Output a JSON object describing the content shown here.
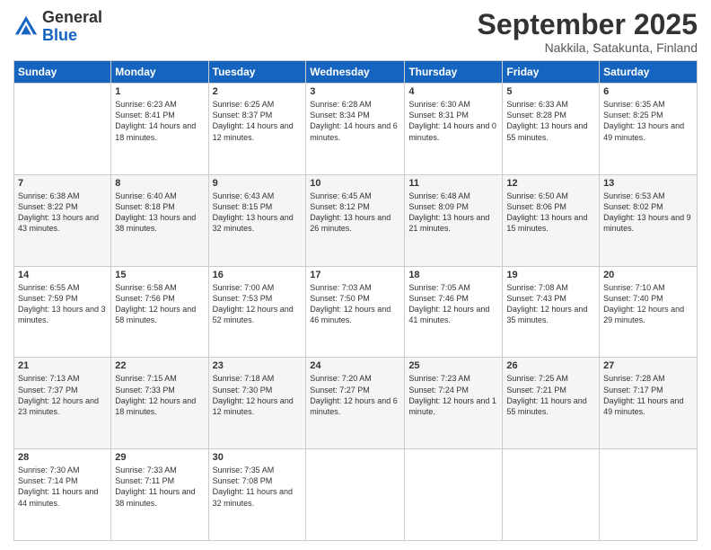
{
  "logo": {
    "general": "General",
    "blue": "Blue"
  },
  "header": {
    "month": "September 2025",
    "location": "Nakkila, Satakunta, Finland"
  },
  "days_of_week": [
    "Sunday",
    "Monday",
    "Tuesday",
    "Wednesday",
    "Thursday",
    "Friday",
    "Saturday"
  ],
  "weeks": [
    [
      {
        "day": "",
        "sunrise": "",
        "sunset": "",
        "daylight": ""
      },
      {
        "day": "1",
        "sunrise": "Sunrise: 6:23 AM",
        "sunset": "Sunset: 8:41 PM",
        "daylight": "Daylight: 14 hours and 18 minutes."
      },
      {
        "day": "2",
        "sunrise": "Sunrise: 6:25 AM",
        "sunset": "Sunset: 8:37 PM",
        "daylight": "Daylight: 14 hours and 12 minutes."
      },
      {
        "day": "3",
        "sunrise": "Sunrise: 6:28 AM",
        "sunset": "Sunset: 8:34 PM",
        "daylight": "Daylight: 14 hours and 6 minutes."
      },
      {
        "day": "4",
        "sunrise": "Sunrise: 6:30 AM",
        "sunset": "Sunset: 8:31 PM",
        "daylight": "Daylight: 14 hours and 0 minutes."
      },
      {
        "day": "5",
        "sunrise": "Sunrise: 6:33 AM",
        "sunset": "Sunset: 8:28 PM",
        "daylight": "Daylight: 13 hours and 55 minutes."
      },
      {
        "day": "6",
        "sunrise": "Sunrise: 6:35 AM",
        "sunset": "Sunset: 8:25 PM",
        "daylight": "Daylight: 13 hours and 49 minutes."
      }
    ],
    [
      {
        "day": "7",
        "sunrise": "Sunrise: 6:38 AM",
        "sunset": "Sunset: 8:22 PM",
        "daylight": "Daylight: 13 hours and 43 minutes."
      },
      {
        "day": "8",
        "sunrise": "Sunrise: 6:40 AM",
        "sunset": "Sunset: 8:18 PM",
        "daylight": "Daylight: 13 hours and 38 minutes."
      },
      {
        "day": "9",
        "sunrise": "Sunrise: 6:43 AM",
        "sunset": "Sunset: 8:15 PM",
        "daylight": "Daylight: 13 hours and 32 minutes."
      },
      {
        "day": "10",
        "sunrise": "Sunrise: 6:45 AM",
        "sunset": "Sunset: 8:12 PM",
        "daylight": "Daylight: 13 hours and 26 minutes."
      },
      {
        "day": "11",
        "sunrise": "Sunrise: 6:48 AM",
        "sunset": "Sunset: 8:09 PM",
        "daylight": "Daylight: 13 hours and 21 minutes."
      },
      {
        "day": "12",
        "sunrise": "Sunrise: 6:50 AM",
        "sunset": "Sunset: 8:06 PM",
        "daylight": "Daylight: 13 hours and 15 minutes."
      },
      {
        "day": "13",
        "sunrise": "Sunrise: 6:53 AM",
        "sunset": "Sunset: 8:02 PM",
        "daylight": "Daylight: 13 hours and 9 minutes."
      }
    ],
    [
      {
        "day": "14",
        "sunrise": "Sunrise: 6:55 AM",
        "sunset": "Sunset: 7:59 PM",
        "daylight": "Daylight: 13 hours and 3 minutes."
      },
      {
        "day": "15",
        "sunrise": "Sunrise: 6:58 AM",
        "sunset": "Sunset: 7:56 PM",
        "daylight": "Daylight: 12 hours and 58 minutes."
      },
      {
        "day": "16",
        "sunrise": "Sunrise: 7:00 AM",
        "sunset": "Sunset: 7:53 PM",
        "daylight": "Daylight: 12 hours and 52 minutes."
      },
      {
        "day": "17",
        "sunrise": "Sunrise: 7:03 AM",
        "sunset": "Sunset: 7:50 PM",
        "daylight": "Daylight: 12 hours and 46 minutes."
      },
      {
        "day": "18",
        "sunrise": "Sunrise: 7:05 AM",
        "sunset": "Sunset: 7:46 PM",
        "daylight": "Daylight: 12 hours and 41 minutes."
      },
      {
        "day": "19",
        "sunrise": "Sunrise: 7:08 AM",
        "sunset": "Sunset: 7:43 PM",
        "daylight": "Daylight: 12 hours and 35 minutes."
      },
      {
        "day": "20",
        "sunrise": "Sunrise: 7:10 AM",
        "sunset": "Sunset: 7:40 PM",
        "daylight": "Daylight: 12 hours and 29 minutes."
      }
    ],
    [
      {
        "day": "21",
        "sunrise": "Sunrise: 7:13 AM",
        "sunset": "Sunset: 7:37 PM",
        "daylight": "Daylight: 12 hours and 23 minutes."
      },
      {
        "day": "22",
        "sunrise": "Sunrise: 7:15 AM",
        "sunset": "Sunset: 7:33 PM",
        "daylight": "Daylight: 12 hours and 18 minutes."
      },
      {
        "day": "23",
        "sunrise": "Sunrise: 7:18 AM",
        "sunset": "Sunset: 7:30 PM",
        "daylight": "Daylight: 12 hours and 12 minutes."
      },
      {
        "day": "24",
        "sunrise": "Sunrise: 7:20 AM",
        "sunset": "Sunset: 7:27 PM",
        "daylight": "Daylight: 12 hours and 6 minutes."
      },
      {
        "day": "25",
        "sunrise": "Sunrise: 7:23 AM",
        "sunset": "Sunset: 7:24 PM",
        "daylight": "Daylight: 12 hours and 1 minute."
      },
      {
        "day": "26",
        "sunrise": "Sunrise: 7:25 AM",
        "sunset": "Sunset: 7:21 PM",
        "daylight": "Daylight: 11 hours and 55 minutes."
      },
      {
        "day": "27",
        "sunrise": "Sunrise: 7:28 AM",
        "sunset": "Sunset: 7:17 PM",
        "daylight": "Daylight: 11 hours and 49 minutes."
      }
    ],
    [
      {
        "day": "28",
        "sunrise": "Sunrise: 7:30 AM",
        "sunset": "Sunset: 7:14 PM",
        "daylight": "Daylight: 11 hours and 44 minutes."
      },
      {
        "day": "29",
        "sunrise": "Sunrise: 7:33 AM",
        "sunset": "Sunset: 7:11 PM",
        "daylight": "Daylight: 11 hours and 38 minutes."
      },
      {
        "day": "30",
        "sunrise": "Sunrise: 7:35 AM",
        "sunset": "Sunset: 7:08 PM",
        "daylight": "Daylight: 11 hours and 32 minutes."
      },
      {
        "day": "",
        "sunrise": "",
        "sunset": "",
        "daylight": ""
      },
      {
        "day": "",
        "sunrise": "",
        "sunset": "",
        "daylight": ""
      },
      {
        "day": "",
        "sunrise": "",
        "sunset": "",
        "daylight": ""
      },
      {
        "day": "",
        "sunrise": "",
        "sunset": "",
        "daylight": ""
      }
    ]
  ]
}
